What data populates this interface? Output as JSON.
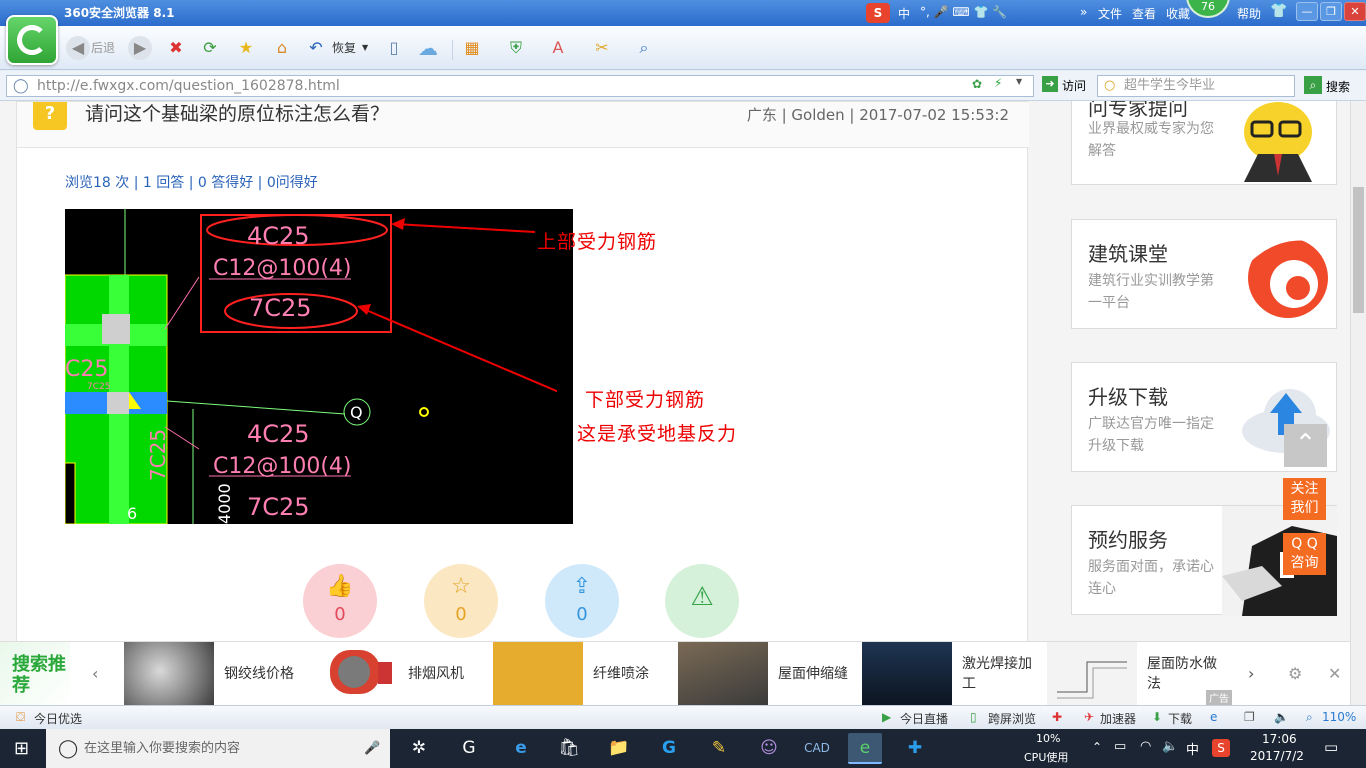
{
  "browser": {
    "title": "360安全浏览器 8.1",
    "menu": [
      "文件",
      "查看",
      "收藏",
      "帮助"
    ],
    "badge": "76",
    "ime": "中",
    "toolbar": {
      "back": "后退",
      "restore": "恢复"
    },
    "address": {
      "url": "http://e.fwxgx.com/question_1602878.html",
      "go": "访问"
    },
    "search": {
      "placeholder": "超牛学生今毕业",
      "button": "搜索"
    }
  },
  "question": {
    "icon": "?",
    "title": "请问这个基础梁的原位标注怎么看？",
    "meta": "广东 | Golden | 2017-07-02 15:53:2",
    "stats": "浏览18 次 | 1 回答 | 0 答得好 | 0问得好",
    "image": {
      "top_label": "4C25",
      "stirrup_label": "C12@100(4)",
      "bottom_label": "7C25",
      "lower_top_label": "4C25",
      "lower_stirrup_label": "C12@100(4)",
      "lower_bottom_label": "7C25",
      "side_label_1": "C25",
      "side_label_2": "7C25",
      "side_label_3": "7C25",
      "axis_label": "Q",
      "dim_label": "4000",
      "num_label": "6",
      "annot_top": "上部受力钢筋",
      "annot_bottom_1": "下部受力钢筋",
      "annot_bottom_2": "这是承受地基反力"
    },
    "actions": [
      {
        "name": "like",
        "icon": "👍",
        "count": "0",
        "bg": "#fad0d4",
        "fg": "#e2495c"
      },
      {
        "name": "favorite",
        "icon": "☆",
        "count": "0",
        "bg": "#fbe7c2",
        "fg": "#e5a425"
      },
      {
        "name": "share",
        "icon": "⇪",
        "count": "0",
        "bg": "#cfe9fb",
        "fg": "#3596de"
      },
      {
        "name": "report",
        "icon": "⚠",
        "count": "",
        "bg": "#d6f1d9",
        "fg": "#35a54a"
      }
    ]
  },
  "sidebar": [
    {
      "title": "问专家提问",
      "desc": "业界最权威专家为您解答"
    },
    {
      "title": "建筑课堂",
      "desc": "建筑行业实训教学第一平台"
    },
    {
      "title": "升级下载",
      "desc": "广联达官方唯一指定升级下载"
    },
    {
      "title": "预约服务",
      "desc": "服务面对面，承诺心连心"
    }
  ],
  "floating": {
    "follow": "关注我们",
    "qq": "Q Q咨询"
  },
  "recommend": {
    "label": "搜索推荐",
    "items": [
      "钢绞线价格",
      "排烟风机",
      "纤维喷涂",
      "屋面伸缩缝",
      "激光焊接加工",
      "屋面防水做法"
    ],
    "ad": "广告"
  },
  "statusbar": {
    "left": "今日优选",
    "items": [
      "今日直播",
      "跨屏浏览",
      "加速器",
      "下载"
    ],
    "zoom": "110%"
  },
  "taskbar": {
    "search_placeholder": "在这里输入你要搜索的内容",
    "cpu": "10%",
    "cpu_label": "CPU使用",
    "ime": "中",
    "time": "17:06",
    "date": "2017/7/2"
  }
}
